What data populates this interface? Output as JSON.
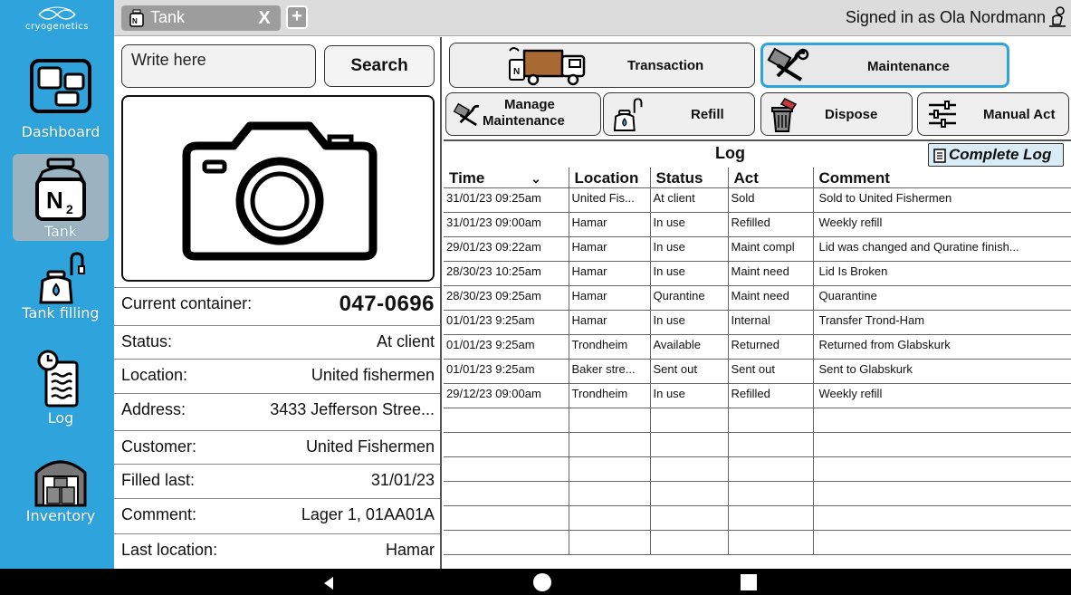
{
  "brand": {
    "name": "cryogenetics"
  },
  "sidebar": {
    "items": [
      {
        "label": "Dashboard",
        "icon": "dashboard-icon"
      },
      {
        "label": "Tank",
        "icon": "nitrogen-tank-icon",
        "active": true
      },
      {
        "label": "Tank filling",
        "icon": "tank-filling-icon"
      },
      {
        "label": "Log",
        "icon": "log-clock-icon"
      },
      {
        "label": "Inventory",
        "icon": "inventory-warehouse-icon"
      }
    ]
  },
  "topbar": {
    "tab_title": "Tank",
    "close_label": "X",
    "add_label": "+",
    "signed_in": "Signed in as Ola Nordmann"
  },
  "search": {
    "placeholder": "Write here",
    "button_label": "Search"
  },
  "container": {
    "current_label": "Current container:",
    "current_value": "047-0696",
    "fields": [
      {
        "key": "Status:",
        "value": "At client"
      },
      {
        "key": "Location:",
        "value": "United fishermen"
      },
      {
        "key": "Address:",
        "value": "3433 Jefferson Stree..."
      },
      {
        "key": "Customer:",
        "value": "United Fishermen"
      },
      {
        "key": "Filled last:",
        "value": "31/01/23"
      },
      {
        "key": "Comment:",
        "value": "Lager 1, 01AA01A"
      },
      {
        "key": "Last location:",
        "value": "Hamar"
      }
    ]
  },
  "actions": {
    "transaction": "Transaction",
    "maintenance": "Maintenance",
    "manage_maintenance_1": "Manage",
    "manage_maintenance_2": "Maintenance",
    "refill": "Refill",
    "dispose": "Dispose",
    "manual_act": "Manual Act"
  },
  "log": {
    "title": "Log",
    "complete_log": "Complete Log",
    "columns": [
      "Time",
      "Location",
      "Status",
      "Act",
      "Comment"
    ],
    "rows": [
      [
        "31/01/23 09:25am",
        "United Fis...",
        "At client",
        "Sold",
        "Sold to United Fishermen"
      ],
      [
        "31/01/23 09:00am",
        "Hamar",
        "In use",
        "Refilled",
        "Weekly refill"
      ],
      [
        "29/01/23 09:22am",
        "Hamar",
        "In use",
        "Maint compl",
        "Lid was changed and Quratine finish..."
      ],
      [
        "28/30/23 10:25am",
        "Hamar",
        "In use",
        "Maint need",
        "Lid Is Broken"
      ],
      [
        "28/30/23 09:25am",
        "Hamar",
        "Qurantine",
        "Maint need",
        "Quarantine"
      ],
      [
        "01/01/23 9:25am",
        "Hamar",
        "In use",
        "Internal",
        "Transfer Trond-Ham"
      ],
      [
        "01/01/23 9:25am",
        "Trondheim",
        "Available",
        "Returned",
        "Returned from Glabskurk"
      ],
      [
        "01/01/23 9:25am",
        "Baker stre...",
        "Sent out",
        "Sent out",
        "Sent to Glabskurk"
      ],
      [
        "29/12/23 09:00am",
        "Trondheim",
        "In use",
        "Refilled",
        "Weekly refill"
      ],
      [
        "",
        "",
        "",
        "",
        ""
      ],
      [
        "",
        "",
        "",
        "",
        ""
      ],
      [
        "",
        "",
        "",
        "",
        ""
      ],
      [
        "",
        "",
        "",
        "",
        ""
      ],
      [
        "",
        "",
        "",
        "",
        ""
      ],
      [
        "",
        "",
        "",
        "",
        ""
      ]
    ]
  },
  "colors": {
    "sidebar": "#2ea3dc",
    "active_nav": "#9bb2c0",
    "selected_border": "#2ea3dc"
  }
}
